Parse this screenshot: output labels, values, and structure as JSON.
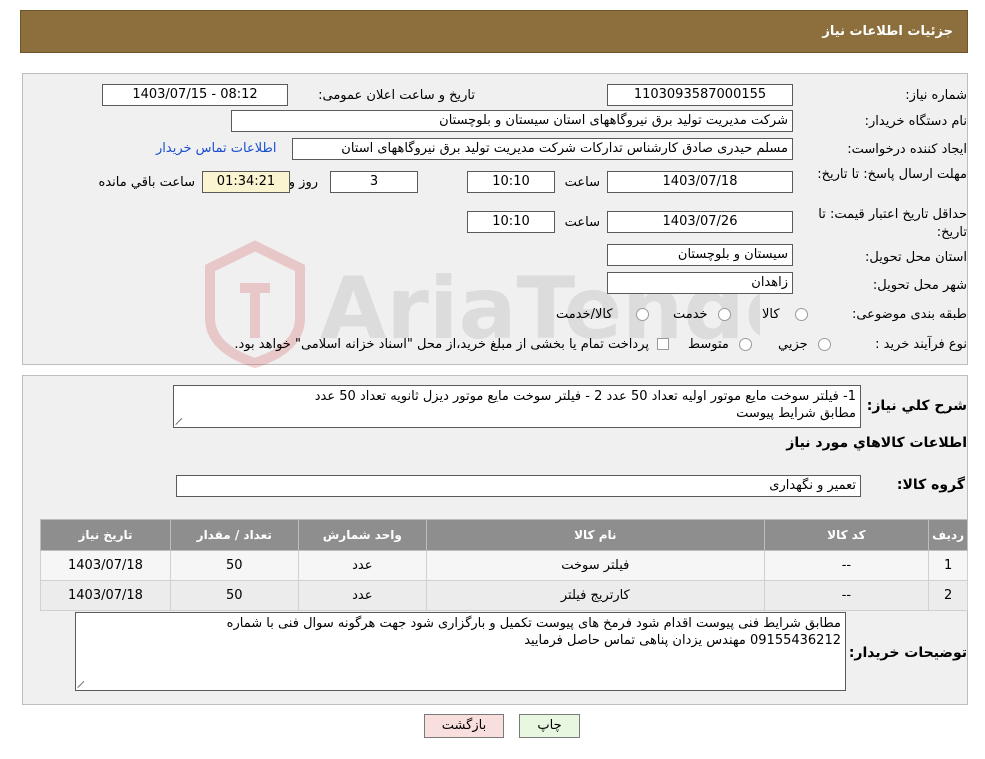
{
  "header": {
    "title": "جزئیات اطلاعات نیاز"
  },
  "labels": {
    "need_number": "شماره نیاز:",
    "announce_datetime": "تاریخ و ساعت اعلان عمومی:",
    "buyer_org": "نام دستگاه خریدار:",
    "requester": "ایجاد کننده درخواست:",
    "deadline": "مهلت ارسال پاسخ: تا تاریخ:",
    "time": "ساعت",
    "days_and": "روز و",
    "time_remaining": "ساعت باقي مانده",
    "price_validity": "حداقل تاریخ اعتبار قیمت: تا تاریخ:",
    "province": "استان محل تحویل:",
    "city": "شهر محل تحویل:",
    "category": "طبقه بندی موضوعی:",
    "process_type": "نوع فرآیند خرید :",
    "description": "شرح کلي نياز:",
    "goods_info": "اطلاعات کالاهاي مورد نياز",
    "goods_group": "گروه کالا:",
    "buyer_notes": "توضیحات خریدار:"
  },
  "values": {
    "need_number": "1103093587000155",
    "announce_datetime": "1403/07/15 - 08:12",
    "buyer_org": "شرکت مدیریت تولید برق نیروگاههای استان سیستان و بلوچستان",
    "requester": "مسلم حیدری صادق کارشناس تدارکات شرکت مدیریت تولید برق نیروگاههای استان",
    "contact_link": "اطلاعات تماس خریدار",
    "deadline_date": "1403/07/18",
    "deadline_time": "10:10",
    "days": "3",
    "remaining": "01:34:21",
    "validity_date": "1403/07/26",
    "validity_time": "10:10",
    "province": "سیستان و بلوچستان",
    "city": "زاهدان",
    "goods_group": "تعمیر و نگهداری"
  },
  "category_options": [
    {
      "label": "کالا",
      "selected": false
    },
    {
      "label": "خدمت",
      "selected": false
    },
    {
      "label": "کالا/خدمت",
      "selected": false
    }
  ],
  "process_options": [
    {
      "label": "جزیي",
      "selected": false
    },
    {
      "label": "متوسط",
      "selected": false
    }
  ],
  "process_note": "پرداخت تمام یا بخشی از مبلغ خرید،از محل \"اسناد خزانه اسلامی\" خواهد بود.",
  "description_lines": [
    "1-  فیلتر  سوخت مایع موتور اولیه  تعداد  50 عدد  2 -  فیلتر سوخت مایع موتور دیزل ثانویه  تعداد 50 عدد",
    "مطابق شرایط پیوست"
  ],
  "table": {
    "headers": [
      "ردیف",
      "کد کالا",
      "نام کالا",
      "واحد شمارش",
      "تعداد / مقدار",
      "تاریخ نیاز"
    ],
    "rows": [
      [
        "1",
        "--",
        "فیلتر سوخت",
        "عدد",
        "50",
        "1403/07/18"
      ],
      [
        "2",
        "--",
        "کارتریج فیلتر",
        "عدد",
        "50",
        "1403/07/18"
      ]
    ]
  },
  "notes_lines": [
    "مطابق شرایط فنی پیوست اقدام شود  فرمخ های پیوست تکمیل و بارگزاری شود  جهت هرگونه سوال  فنی با شماره",
    "09155436212 مهندس یزدان پناهی تماس حاصل فرمایید"
  ],
  "buttons": {
    "print": "چاپ",
    "back": "بازگشت"
  },
  "watermark": {
    "text": "AriaTender.neT"
  },
  "colors": {
    "header": "#8d6f3d",
    "link": "#1a4fd0",
    "back_button": "#f9dede",
    "print_button": "#e8f8e0"
  }
}
